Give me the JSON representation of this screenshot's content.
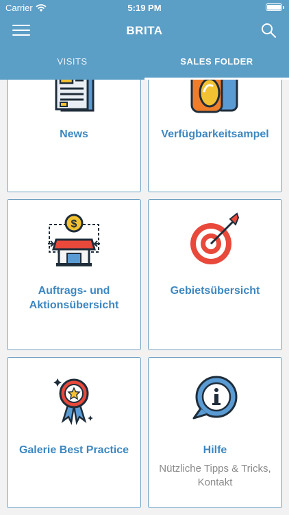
{
  "status_bar": {
    "carrier": "Carrier",
    "time": "5:19 PM"
  },
  "header": {
    "title": "BRITA"
  },
  "tabs": [
    {
      "label": "VISITS",
      "active": false
    },
    {
      "label": "SALES FOLDER",
      "active": true
    }
  ],
  "tiles": [
    {
      "title": "News",
      "icon": "newspaper-icon"
    },
    {
      "title": "Verfügbarkeitsampel",
      "icon": "traffic-light-icon"
    },
    {
      "title": "Auftrags- und Aktionsübersicht",
      "icon": "shop-dollar-icon"
    },
    {
      "title": "Gebietsübersicht",
      "icon": "target-icon"
    },
    {
      "title": "Galerie Best Practice",
      "icon": "award-ribbon-icon"
    },
    {
      "title": "Hilfe",
      "subtitle": "Nützliche Tipps & Tricks, Kontakt",
      "icon": "info-bubble-icon"
    }
  ],
  "colors": {
    "header": "#5b9ec6",
    "tile_title": "#3d87c0",
    "tile_border": "#6e9fc0",
    "background": "#f2f2f2"
  }
}
